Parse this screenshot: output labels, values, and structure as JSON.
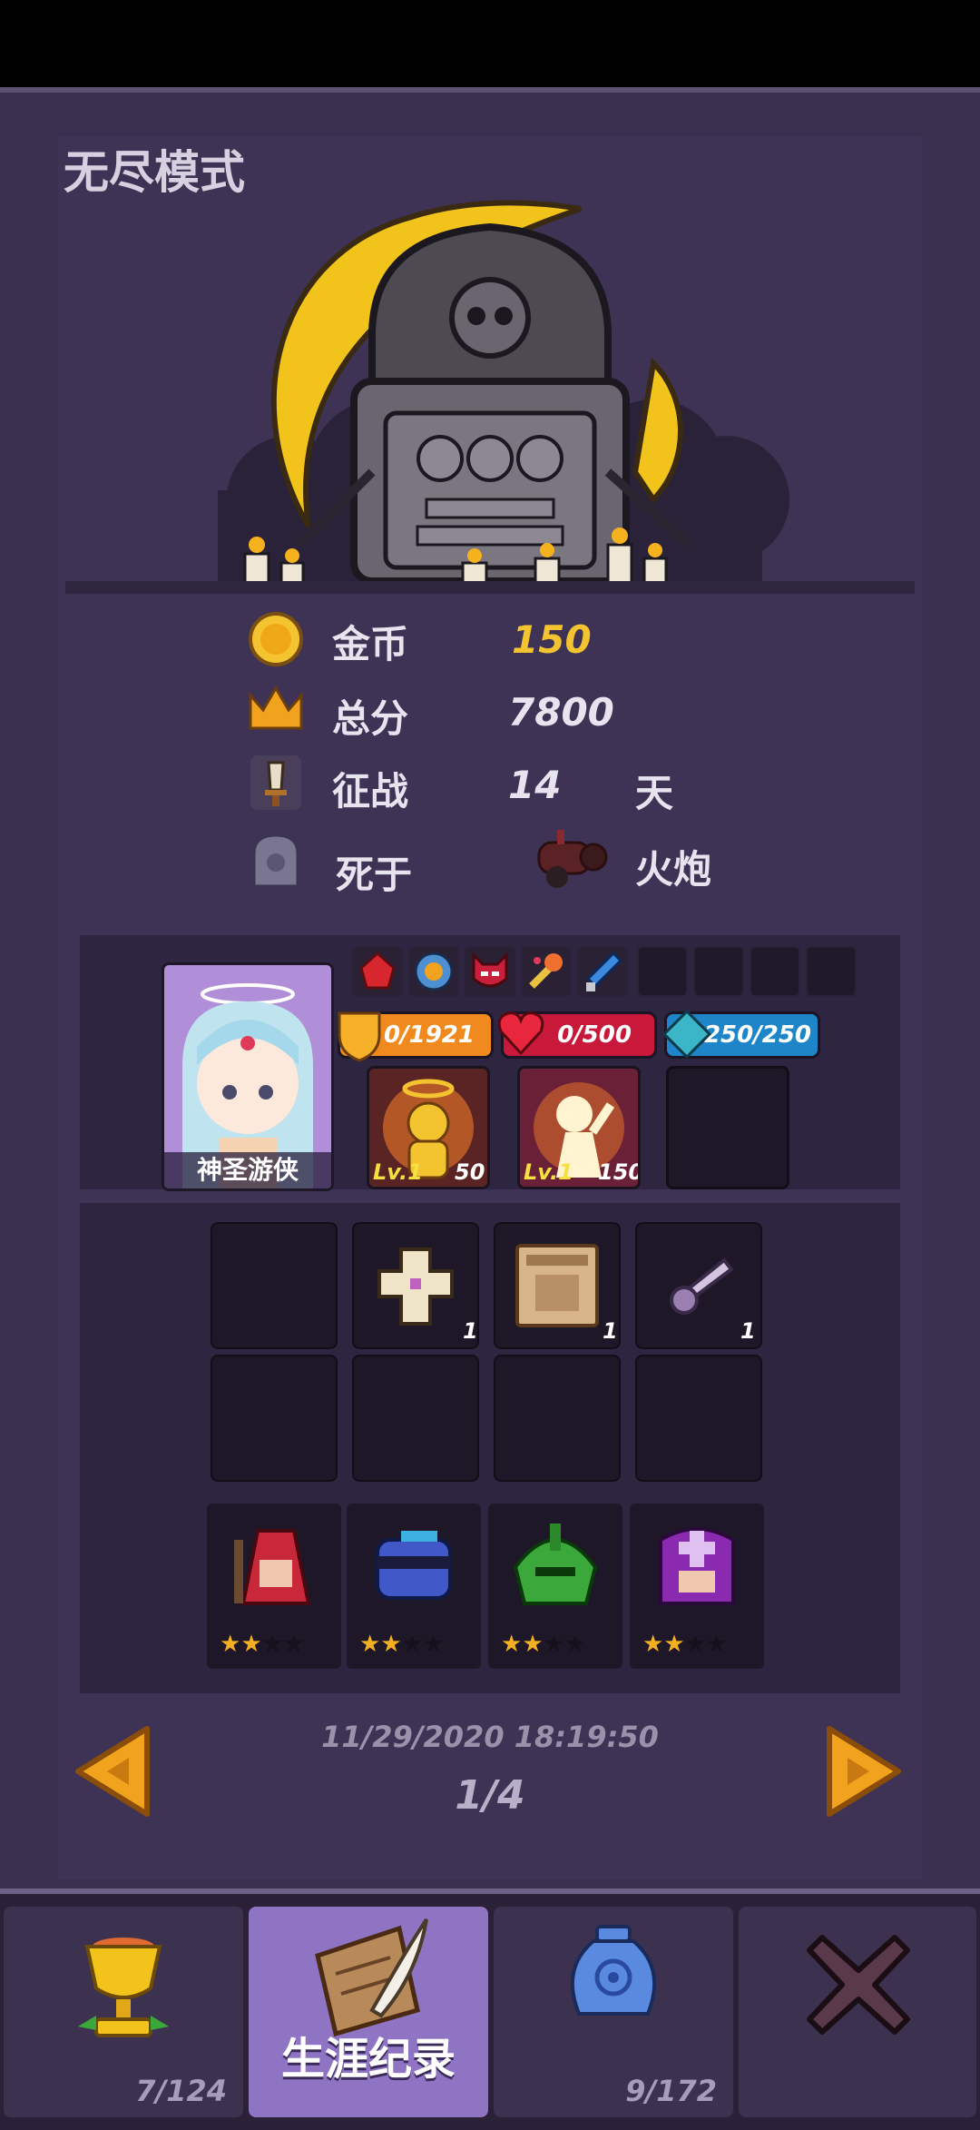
{
  "mode_title": "无尽模式",
  "stats": {
    "gold_label": "金币",
    "gold_value": "150",
    "score_label": "总分",
    "score_value": "7800",
    "days_label": "征战",
    "days_value": "14",
    "days_unit": "天",
    "death_label": "死于",
    "death_cause": "火炮"
  },
  "hero": {
    "name": "神圣游侠",
    "shield": "0/1921",
    "health": "0/500",
    "mana": "250/250",
    "skills": [
      {
        "level": "Lv.1",
        "cost": "50"
      },
      {
        "level": "Lv.1",
        "cost": "150"
      }
    ]
  },
  "items": [
    {
      "icon": "empty",
      "count": ""
    },
    {
      "icon": "cross-icon",
      "count": "1"
    },
    {
      "icon": "wanted-poster-icon",
      "count": "1"
    },
    {
      "icon": "dagger-icon",
      "count": "1"
    }
  ],
  "allies": [
    {
      "icon": "red-wizard-icon",
      "stars": 2,
      "max_stars": 4
    },
    {
      "icon": "blue-ninja-icon",
      "stars": 2,
      "max_stars": 4
    },
    {
      "icon": "green-knight-icon",
      "stars": 2,
      "max_stars": 4
    },
    {
      "icon": "purple-priest-icon",
      "stars": 2,
      "max_stars": 4
    }
  ],
  "record": {
    "timestamp": "11/29/2020 18:19:50",
    "page": "1/4"
  },
  "tabs": {
    "trophy_count": "7/124",
    "career_label": "生涯纪录",
    "vase_count": "9/172"
  },
  "colors": {
    "gold": "#f4c430",
    "shield_bar": "#f08a1e",
    "health_bar": "#c8193a",
    "mana_bar": "#1e86c8",
    "accent": "#8f74c4"
  }
}
